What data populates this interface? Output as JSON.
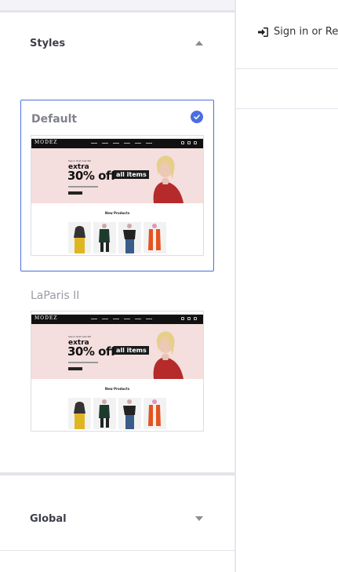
{
  "styles_section": {
    "title": "Styles",
    "expanded": true,
    "options": [
      {
        "name": "Default",
        "selected": true,
        "preview": {
          "logo": "MODEZ",
          "hero_small": "See in that new fall",
          "hero_extra": "extra",
          "hero_offer": "30% off",
          "hero_pill": "all items",
          "products_title": "New Products"
        }
      },
      {
        "name": "LaParis II",
        "selected": false,
        "preview": {
          "logo": "MODEZ",
          "hero_small": "See in that new fall",
          "hero_extra": "extra",
          "hero_offer": "30% off",
          "hero_pill": "all items",
          "products_title": "New Products"
        }
      }
    ]
  },
  "global_section": {
    "title": "Global",
    "expanded": false
  },
  "header": {
    "signin_label": "Sign in or Register",
    "signin_icon": "sign-in-icon"
  },
  "colors": {
    "accent": "#4a6ee0",
    "hero_bg": "#f5dede"
  }
}
